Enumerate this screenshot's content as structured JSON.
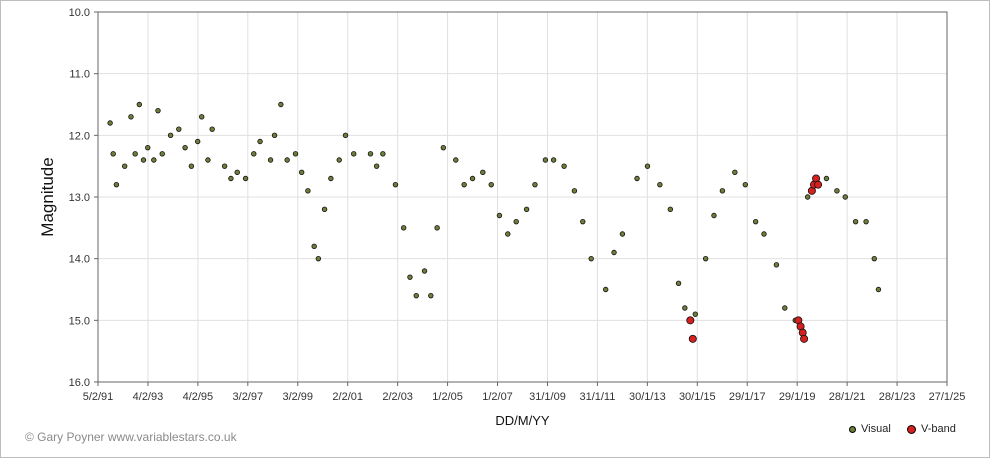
{
  "credit": "© Gary Poyner www.variablestars.co.uk",
  "colors": {
    "visual": "#6b7f3a",
    "vband": "#d61f1f",
    "grid": "#e0e0e0"
  },
  "chart_data": {
    "type": "scatter",
    "xlabel": "DD/M/YY",
    "ylabel": "Magnitude",
    "y_inverted": true,
    "ylim": [
      10.0,
      16.0
    ],
    "yticks": [
      "10.0",
      "11.0",
      "12.0",
      "13.0",
      "14.0",
      "15.0",
      "16.0"
    ],
    "xticks": [
      "5/2/91",
      "4/2/93",
      "4/2/95",
      "3/2/97",
      "3/2/99",
      "2/2/01",
      "2/2/03",
      "1/2/05",
      "1/2/07",
      "31/1/09",
      "31/1/11",
      "30/1/13",
      "30/1/15",
      "29/1/17",
      "29/1/19",
      "28/1/21",
      "28/1/23",
      "27/1/25"
    ],
    "grid": true,
    "legend_position": "bottom-right",
    "series": [
      {
        "name": "Visual",
        "points": [
          [
            "1991-08-01",
            11.8
          ],
          [
            "1991-09-15",
            12.3
          ],
          [
            "1991-11-01",
            12.8
          ],
          [
            "1992-03-01",
            12.5
          ],
          [
            "1992-06-01",
            11.7
          ],
          [
            "1992-08-01",
            12.3
          ],
          [
            "1992-10-01",
            11.5
          ],
          [
            "1992-12-01",
            12.4
          ],
          [
            "1993-02-01",
            12.2
          ],
          [
            "1993-05-01",
            12.4
          ],
          [
            "1993-07-01",
            11.6
          ],
          [
            "1993-09-01",
            12.3
          ],
          [
            "1994-01-01",
            12.0
          ],
          [
            "1994-05-01",
            11.9
          ],
          [
            "1994-08-01",
            12.2
          ],
          [
            "1994-11-01",
            12.5
          ],
          [
            "1995-02-01",
            12.1
          ],
          [
            "1995-04-01",
            11.7
          ],
          [
            "1995-07-01",
            12.4
          ],
          [
            "1995-09-01",
            11.9
          ],
          [
            "1996-03-01",
            12.5
          ],
          [
            "1996-06-01",
            12.7
          ],
          [
            "1996-09-01",
            12.6
          ],
          [
            "1997-01-01",
            12.7
          ],
          [
            "1997-05-01",
            12.3
          ],
          [
            "1997-08-01",
            12.1
          ],
          [
            "1998-01-01",
            12.4
          ],
          [
            "1998-03-01",
            12.0
          ],
          [
            "1998-06-01",
            11.5
          ],
          [
            "1998-09-01",
            12.4
          ],
          [
            "1999-01-01",
            12.3
          ],
          [
            "1999-04-01",
            12.6
          ],
          [
            "1999-07-01",
            12.9
          ],
          [
            "1999-10-01",
            13.8
          ],
          [
            "1999-12-01",
            14.0
          ],
          [
            "2000-03-01",
            13.2
          ],
          [
            "2000-06-01",
            12.7
          ],
          [
            "2000-10-01",
            12.4
          ],
          [
            "2001-01-01",
            12.0
          ],
          [
            "2001-05-01",
            12.3
          ],
          [
            "2002-01-01",
            12.3
          ],
          [
            "2002-04-01",
            12.5
          ],
          [
            "2002-07-01",
            12.3
          ],
          [
            "2003-01-01",
            12.8
          ],
          [
            "2003-05-01",
            13.5
          ],
          [
            "2003-08-01",
            14.3
          ],
          [
            "2003-11-01",
            14.6
          ],
          [
            "2004-03-01",
            14.2
          ],
          [
            "2004-06-01",
            14.6
          ],
          [
            "2004-09-01",
            13.5
          ],
          [
            "2004-12-01",
            12.2
          ],
          [
            "2005-06-01",
            12.4
          ],
          [
            "2005-10-01",
            12.8
          ],
          [
            "2006-02-01",
            12.7
          ],
          [
            "2006-07-01",
            12.6
          ],
          [
            "2006-11-01",
            12.8
          ],
          [
            "2007-03-01",
            13.3
          ],
          [
            "2007-07-01",
            13.6
          ],
          [
            "2007-11-01",
            13.4
          ],
          [
            "2008-04-01",
            13.2
          ],
          [
            "2008-08-01",
            12.8
          ],
          [
            "2009-01-01",
            12.4
          ],
          [
            "2009-05-01",
            12.4
          ],
          [
            "2009-10-01",
            12.5
          ],
          [
            "2010-03-01",
            12.9
          ],
          [
            "2010-07-01",
            13.4
          ],
          [
            "2010-11-01",
            14.0
          ],
          [
            "2011-06-01",
            14.5
          ],
          [
            "2011-10-01",
            13.9
          ],
          [
            "2012-02-01",
            13.6
          ],
          [
            "2012-09-01",
            12.7
          ],
          [
            "2013-02-01",
            12.5
          ],
          [
            "2013-08-01",
            12.8
          ],
          [
            "2014-01-01",
            13.2
          ],
          [
            "2014-05-01",
            14.4
          ],
          [
            "2014-08-01",
            14.8
          ],
          [
            "2015-01-01",
            14.9
          ],
          [
            "2015-06-01",
            14.0
          ],
          [
            "2015-10-01",
            13.3
          ],
          [
            "2016-02-01",
            12.9
          ],
          [
            "2016-08-01",
            12.6
          ],
          [
            "2017-01-01",
            12.8
          ],
          [
            "2017-06-01",
            13.4
          ],
          [
            "2017-10-01",
            13.6
          ],
          [
            "2018-04-01",
            14.1
          ],
          [
            "2018-08-01",
            14.8
          ],
          [
            "2019-01-01",
            15.0
          ],
          [
            "2019-07-01",
            13.0
          ],
          [
            "2019-12-01",
            12.8
          ],
          [
            "2020-04-01",
            12.7
          ],
          [
            "2020-09-01",
            12.9
          ],
          [
            "2021-01-01",
            13.0
          ],
          [
            "2021-06-01",
            13.4
          ],
          [
            "2021-11-01",
            13.4
          ],
          [
            "2022-03-01",
            14.0
          ],
          [
            "2022-05-01",
            14.5
          ]
        ]
      },
      {
        "name": "V-band",
        "points": [
          [
            "2014-10-20",
            15.0
          ],
          [
            "2014-11-25",
            15.3
          ],
          [
            "2019-02-15",
            15.0
          ],
          [
            "2019-03-20",
            15.1
          ],
          [
            "2019-04-20",
            15.2
          ],
          [
            "2019-05-10",
            15.3
          ],
          [
            "2019-09-01",
            12.9
          ],
          [
            "2019-10-01",
            12.8
          ],
          [
            "2019-11-01",
            12.7
          ],
          [
            "2019-12-01",
            12.8
          ]
        ]
      }
    ]
  }
}
